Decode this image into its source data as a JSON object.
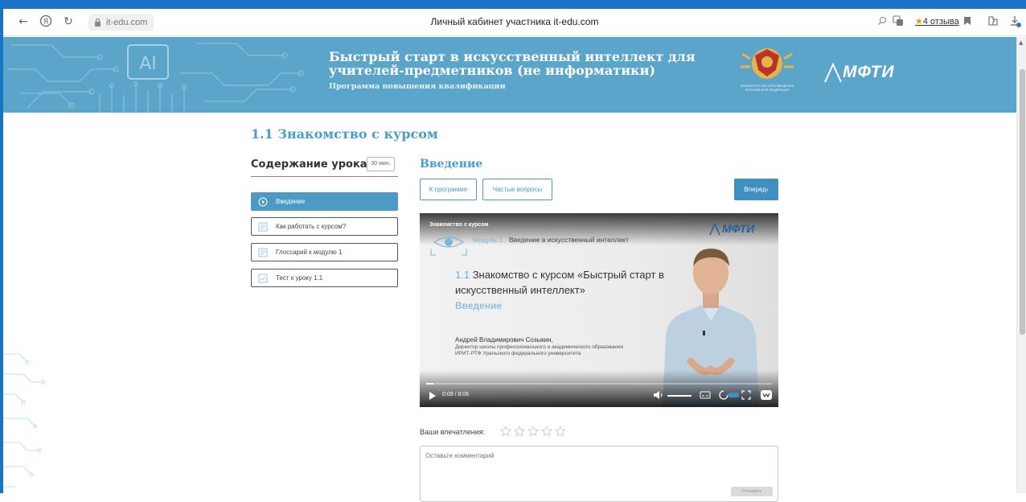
{
  "browser": {
    "url": "it-edu.com",
    "tab_title": "Личный кабинет участника it-edu.com",
    "reviews": "4 отзыва",
    "reviews_star": "★"
  },
  "banner": {
    "title": "Быстрый старт в искусственный интеллект для учителей-предметников (не информатики)",
    "subtitle": "Программа повышения квалификации",
    "ministry_caption": "МИНИСТЕРСТВО ПРОСВЕЩЕНИЯ РОССИЙСКОЙ ФЕДЕРАЦИИ",
    "partner_logo": "МФТИ",
    "ai_badge": "AI"
  },
  "lesson": {
    "heading": "1.1 Знакомство с курсом",
    "toc_title": "Содержание урока",
    "duration": "30 мин.",
    "items": [
      {
        "label": "Введение",
        "active": true
      },
      {
        "label": "Как работать с курсом?",
        "active": false
      },
      {
        "label": "Глоссарий к модулю 1",
        "active": false
      },
      {
        "label": "Тест к уроку 1.1",
        "active": false
      }
    ]
  },
  "main": {
    "section_title": "Введение",
    "btn_program": "К программе",
    "btn_faq": "Частые вопросы",
    "btn_next": "Вперед›"
  },
  "video": {
    "tag": "Знакомство с курсом",
    "logo": "МФТИ",
    "module_num": "Модуль 1.",
    "module_name": "Введение в искусственный интеллект",
    "title_num": "1.1",
    "title_text": "Знакомство с курсом «Быстрый старт в искусственный интеллект»",
    "subtitle": "Введение",
    "speaker_name": "Андрей Владимирович Созыкин,",
    "speaker_role": "Директор школы профессионального и академического образования ИРИТ-РТФ Уральского федерального университета",
    "time": "0:09 / 8:06",
    "progress": 0.02
  },
  "feedback": {
    "rating_label": "Ваши впечатления:",
    "rating_value": 0,
    "rating_max": 5,
    "comment_placeholder": "Оставьте комментарий",
    "submit_label": "Отправить"
  },
  "colors": {
    "accent": "#4b9dc9",
    "banner": "#5aa5c9",
    "frame": "#1b73c6"
  }
}
